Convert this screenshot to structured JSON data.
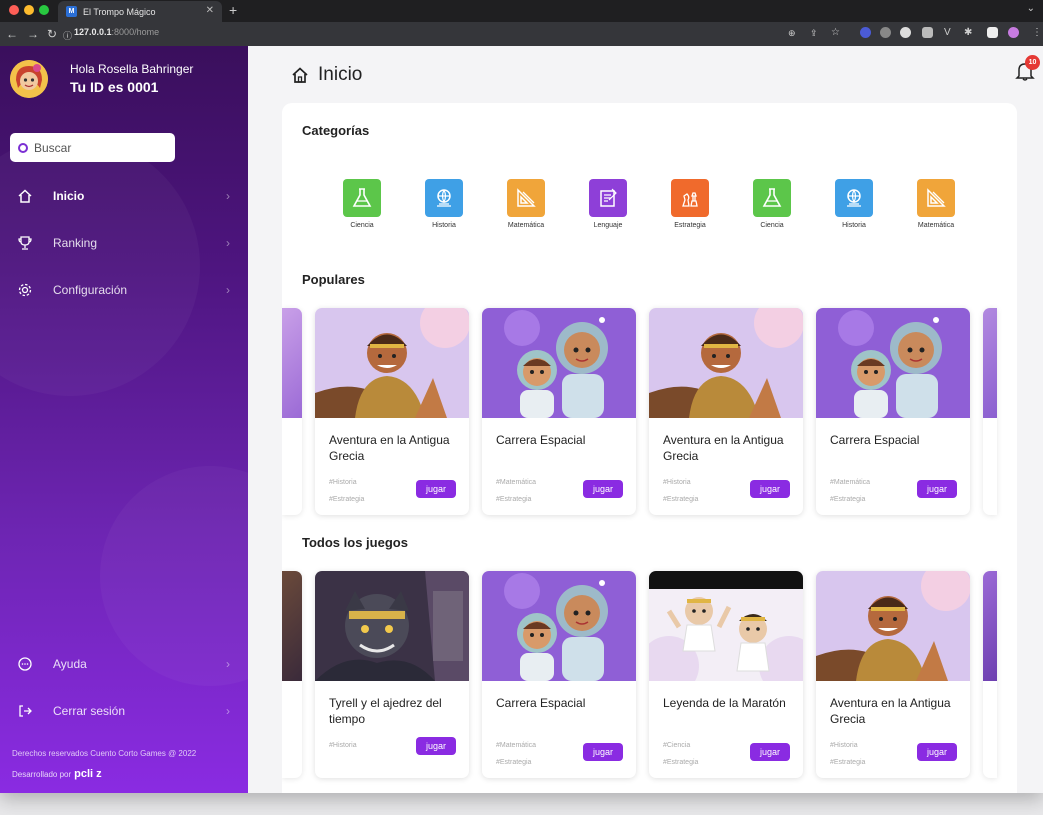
{
  "browser": {
    "tab_title": "El Trompo Mágico",
    "tab_favicon": "M",
    "url_host": "127.0.0.1",
    "url_rest": ":8000/home",
    "notification_count": "10"
  },
  "sidebar": {
    "greeting": "Hola Rosella Bahringer",
    "user_id": "Tu ID es 0001",
    "search_placeholder": "Buscar",
    "items": [
      {
        "label": "Inicio",
        "icon": "home-icon"
      },
      {
        "label": "Ranking",
        "icon": "trophy-icon"
      },
      {
        "label": "Configuración",
        "icon": "gear-icon"
      }
    ],
    "bottom_items": [
      {
        "label": "Ayuda",
        "icon": "help-chat-icon"
      },
      {
        "label": "Cerrar sesión",
        "icon": "logout-icon"
      }
    ],
    "footer_rights": "Derechos reservados Cuento Corto Games @ 2022",
    "footer_dev": "Desarrollado por",
    "footer_brand": "pcli z"
  },
  "main": {
    "title": "Inicio",
    "sections": {
      "categories": "Categorías",
      "popular": "Populares",
      "all_games": "Todos los juegos"
    },
    "categories": [
      {
        "label": "Ciencia",
        "icon": "flask-icon",
        "color": "#5cc64a"
      },
      {
        "label": "Historia",
        "icon": "globe-icon",
        "color": "#3fa0e6"
      },
      {
        "label": "Matemática",
        "icon": "triangle-ruler-icon",
        "color": "#f0a53a"
      },
      {
        "label": "Lenguaje",
        "icon": "book-pen-icon",
        "color": "#8e3fd8"
      },
      {
        "label": "Estrategia",
        "icon": "chess-icon",
        "color": "#f06a2c"
      },
      {
        "label": "Ciencia",
        "icon": "flask-icon",
        "color": "#5cc64a"
      },
      {
        "label": "Historia",
        "icon": "globe-icon",
        "color": "#3fa0e6"
      },
      {
        "label": "Matemática",
        "icon": "triangle-ruler-icon",
        "color": "#f0a53a"
      }
    ],
    "popular": [
      {
        "title": "Aventura en la Antigua Grecia",
        "tags": [
          "#Historia",
          "#Estrategia"
        ],
        "button": "jugar",
        "art": "hero"
      },
      {
        "title": "Carrera Espacial",
        "tags": [
          "#Matemática",
          "#Estrategia"
        ],
        "button": "jugar",
        "art": "astronauts"
      },
      {
        "title": "Aventura en la Antigua Grecia",
        "tags": [
          "#Historia",
          "#Estrategia"
        ],
        "button": "jugar",
        "art": "hero"
      },
      {
        "title": "Carrera Espacial",
        "tags": [
          "#Matemática",
          "#Estrategia"
        ],
        "button": "jugar",
        "art": "astronauts"
      }
    ],
    "all_games": [
      {
        "title": "Tyrell y el ajedrez del tiempo",
        "tags": [
          "#Historia"
        ],
        "button": "jugar",
        "art": "beast"
      },
      {
        "title": "Carrera Espacial",
        "tags": [
          "#Matemática",
          "#Estrategia"
        ],
        "button": "jugar",
        "art": "astronauts"
      },
      {
        "title": "Leyenda de la Maratón",
        "tags": [
          "#Ciencia",
          "#Estrategia"
        ],
        "button": "jugar",
        "art": "runners"
      },
      {
        "title": "Aventura en la Antigua Grecia",
        "tags": [
          "#Historia",
          "#Estrategia"
        ],
        "button": "jugar",
        "art": "hero"
      }
    ]
  }
}
